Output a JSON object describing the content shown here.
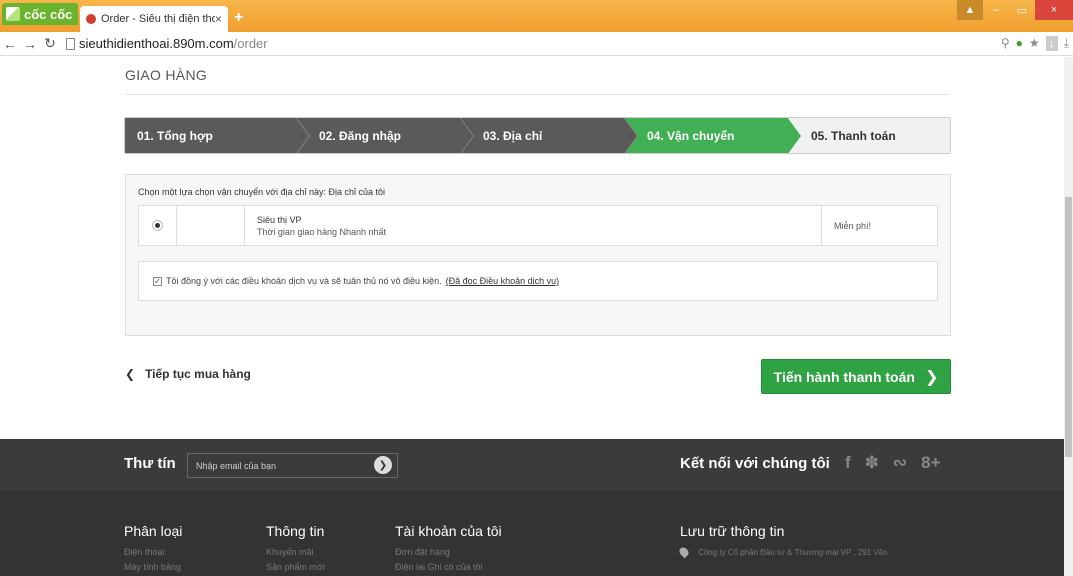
{
  "browser": {
    "brand": "cốc cốc",
    "tab_title": "Order - Siêu thị điện thoại",
    "tab_close": "×",
    "new_tab": "+",
    "url_host": "sieuthidienthoai.890m.com",
    "url_path": "/order",
    "win_min": "–",
    "win_restore": "▭",
    "win_close": "×"
  },
  "page": {
    "section_title": "GIAO HÀNG",
    "steps": [
      {
        "label": "01. Tổng hợp",
        "state": "done"
      },
      {
        "label": "02. Đăng nhập",
        "state": "done"
      },
      {
        "label": "03. Địa chỉ",
        "state": "done"
      },
      {
        "label": "04. Vận chuyển",
        "state": "current"
      },
      {
        "label": "05. Thanh toán",
        "state": "todo"
      }
    ],
    "shipping": {
      "intro": "Chọn một lựa chọn vận chuyển với địa chỉ này: Địa chỉ của tôi",
      "carrier": {
        "selected": true,
        "name": "Siêu thị VP",
        "delay": "Thời gian giao hàng Nhanh nhất",
        "price": "Miễn phí!"
      },
      "terms": {
        "checked": true,
        "text": "Tôi đồng ý với các điều khoản dịch vụ và sẽ tuân thủ nó vô điều kiện.",
        "link": "(Đã đọc Điều khoản dịch vụ)"
      }
    },
    "continue_label": "Tiếp tục mua hàng",
    "checkout_label": "Tiến hành thanh toán"
  },
  "footer": {
    "newsletter_label": "Thư tín",
    "newsletter_placeholder": "Nhập email của bạn",
    "social_label": "Kết nối với chúng tôi",
    "social_icons": [
      "f",
      "t",
      "rss",
      "8+"
    ],
    "columns": [
      {
        "head": "Phân loại",
        "items": [
          "Điện thoại",
          "Máy tính bảng"
        ]
      },
      {
        "head": "Thông tin",
        "items": [
          "Khuyến mãi",
          "Sản phẩm mới"
        ]
      },
      {
        "head": "Tài khoản của tôi",
        "items": [
          "Đơn đặt hàng",
          "Điện lại Ghi có của tôi"
        ]
      }
    ],
    "store_head": "Lưu trữ thông tin",
    "store_address": "Công ty Cổ phần Đầu tư & Thương mại VP , 291 Văn"
  },
  "colors": {
    "brand_green": "#41b054",
    "checkout_green": "#2fa244",
    "footer_dark": "#333333",
    "browser_orange": "#f2a93b"
  }
}
